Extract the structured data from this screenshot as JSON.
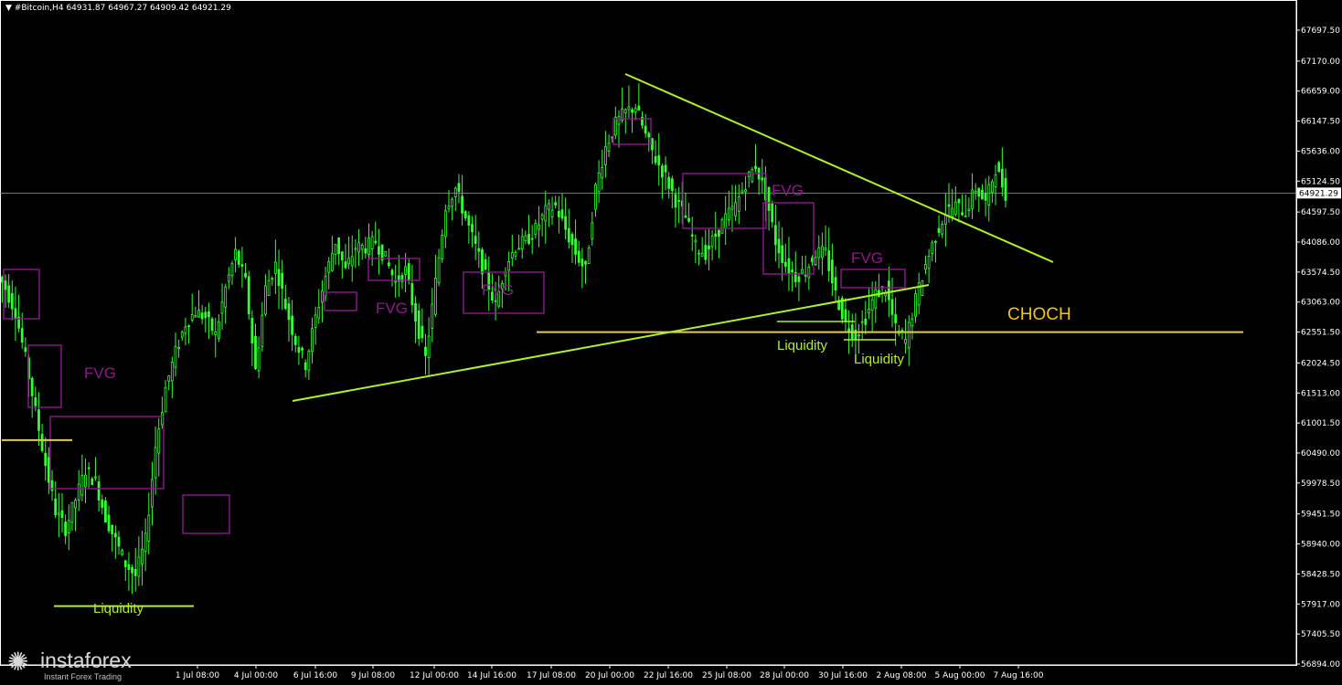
{
  "header": {
    "symbol": "#Bitcoin,H4",
    "ohlc": "64931.87 64967.27 64909.42 64921.29"
  },
  "colors": {
    "background": "#000000",
    "candle": "#33ff33",
    "grid_axis": "#ffffff",
    "fvg": "#8b1a8b",
    "trendline": "#aef02a",
    "level": "#e6c84a",
    "liquidity_text": "#aef02a"
  },
  "watermark": {
    "brand": "instaforex",
    "tagline": "Instant Forex Trading",
    "icon": "instaforex-logo-icon"
  },
  "chart_data": {
    "type": "candlestick",
    "timeframe": "H4",
    "ylim": [
      56894.0,
      68209.0
    ],
    "y_ticks": [
      "67697.50",
      "67170.00",
      "66659.00",
      "66147.50",
      "65636.00",
      "65124.50",
      "64597.50",
      "64086.00",
      "63574.50",
      "63063.00",
      "62551.50",
      "62024.50",
      "61513.00",
      "61001.50",
      "60490.00",
      "59978.50",
      "59451.50",
      "58940.00",
      "58428.50",
      "57917.00",
      "57405.50",
      "56894.00"
    ],
    "x_ticks": [
      "1 Jul 08:00",
      "4 Jul 00:00",
      "6 Jul 16:00",
      "9 Jul 08:00",
      "12 Jul 00:00",
      "14 Jul 16:00",
      "17 Jul 08:00",
      "20 Jul 00:00",
      "22 Jul 16:00",
      "25 Jul 08:00",
      "28 Jul 00:00",
      "30 Jul 16:00",
      "2 Aug 08:00",
      "5 Aug 00:00",
      "7 Aug 16:00"
    ],
    "current_price": "64921.29",
    "current_price_value": 64921.29,
    "series": [
      {
        "close": [
          63300,
          62900,
          62100,
          61200,
          60300,
          59500,
          59200,
          59700,
          60200,
          60000,
          59400,
          59000,
          58600,
          58400,
          59000,
          60600,
          61600,
          62200,
          62700,
          62900,
          62800,
          62500,
          63300,
          63900,
          63400,
          61900,
          63300,
          63700,
          63000,
          62400,
          62000,
          62800,
          63500,
          64100,
          63600,
          64000,
          64000,
          64100,
          63800,
          63400,
          63600,
          62800,
          62100,
          63400,
          64700,
          65000,
          64500,
          64000,
          63500,
          63000,
          63700,
          64000,
          64100,
          64300,
          64600,
          64700,
          64300,
          63900,
          63600,
          65000,
          65700,
          66100,
          66300,
          66400,
          65900,
          65500,
          65200,
          64800,
          64500,
          64000,
          63900,
          64200,
          64500,
          64700,
          65100,
          65400,
          64900,
          64100,
          63700,
          63500,
          63600,
          63900,
          63900,
          63200,
          62700,
          62500,
          62800,
          63200,
          63300,
          62600,
          62400,
          63100,
          63700,
          64200,
          64600,
          64700,
          64600,
          65000,
          64750,
          65350,
          64920
        ]
      }
    ],
    "annotations": {
      "fvg_labels": [
        "FVG",
        "FVG",
        "FVG",
        "FVG",
        "FVG"
      ],
      "liquidity_labels": [
        "Liquidity",
        "Liquidity",
        "Liquidity"
      ],
      "choch_label": "CHOCH",
      "levels": [
        60710,
        62550,
        57880
      ],
      "trendlines": [
        {
          "from": {
            "x": "6 Jul 16:00",
            "y": 61400
          },
          "to": {
            "x": "2 Aug 08:00",
            "y": 63300
          }
        },
        {
          "from": {
            "x": "20 Jul 00:00",
            "y": 66900
          },
          "to": {
            "x": "7 Aug 16:00",
            "y": 63700
          }
        }
      ]
    }
  }
}
